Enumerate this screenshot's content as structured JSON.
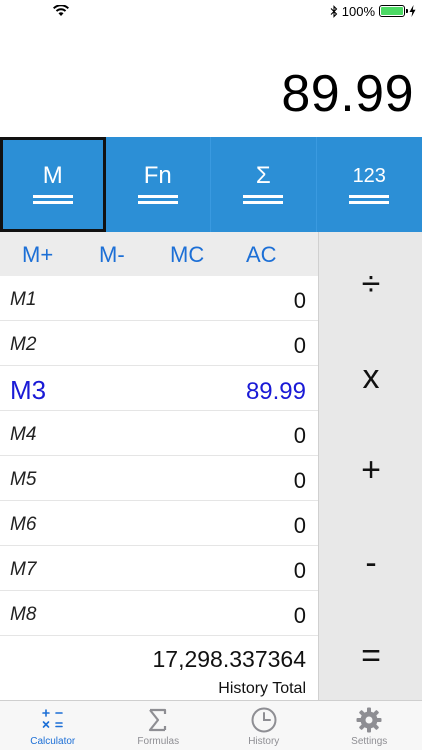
{
  "status_bar": {
    "battery_percent": "100%"
  },
  "display": {
    "value": "89.99"
  },
  "mode_tabs": [
    {
      "label": "M",
      "active": true
    },
    {
      "label": "Fn",
      "active": false
    },
    {
      "label": "Σ",
      "active": false
    },
    {
      "label": "123",
      "active": false
    }
  ],
  "memory_ops": [
    "M+",
    "M-",
    "MC",
    "AC"
  ],
  "memory": [
    {
      "label": "M1",
      "value": "0"
    },
    {
      "label": "M2",
      "value": "0"
    },
    {
      "label": "M3",
      "value": "89.99",
      "active": true
    },
    {
      "label": "M4",
      "value": "0"
    },
    {
      "label": "M5",
      "value": "0"
    },
    {
      "label": "M6",
      "value": "0"
    },
    {
      "label": "M7",
      "value": "0"
    },
    {
      "label": "M8",
      "value": "0"
    }
  ],
  "history": {
    "value": "17,298.337364",
    "label": "History Total"
  },
  "operators": [
    "÷",
    "x",
    "+",
    "-",
    "="
  ],
  "tab_bar": [
    {
      "label": "Calculator",
      "icon": "calculator-icon",
      "active": true
    },
    {
      "label": "Formulas",
      "icon": "sigma-icon",
      "active": false
    },
    {
      "label": "History",
      "icon": "clock-icon",
      "active": false
    },
    {
      "label": "Settings",
      "icon": "gear-icon",
      "active": false
    }
  ],
  "colors": {
    "accent": "#2c8fd6",
    "active_memory": "#1a1ad6",
    "tab_active": "#1c6fd6",
    "battery": "#4cd964"
  }
}
